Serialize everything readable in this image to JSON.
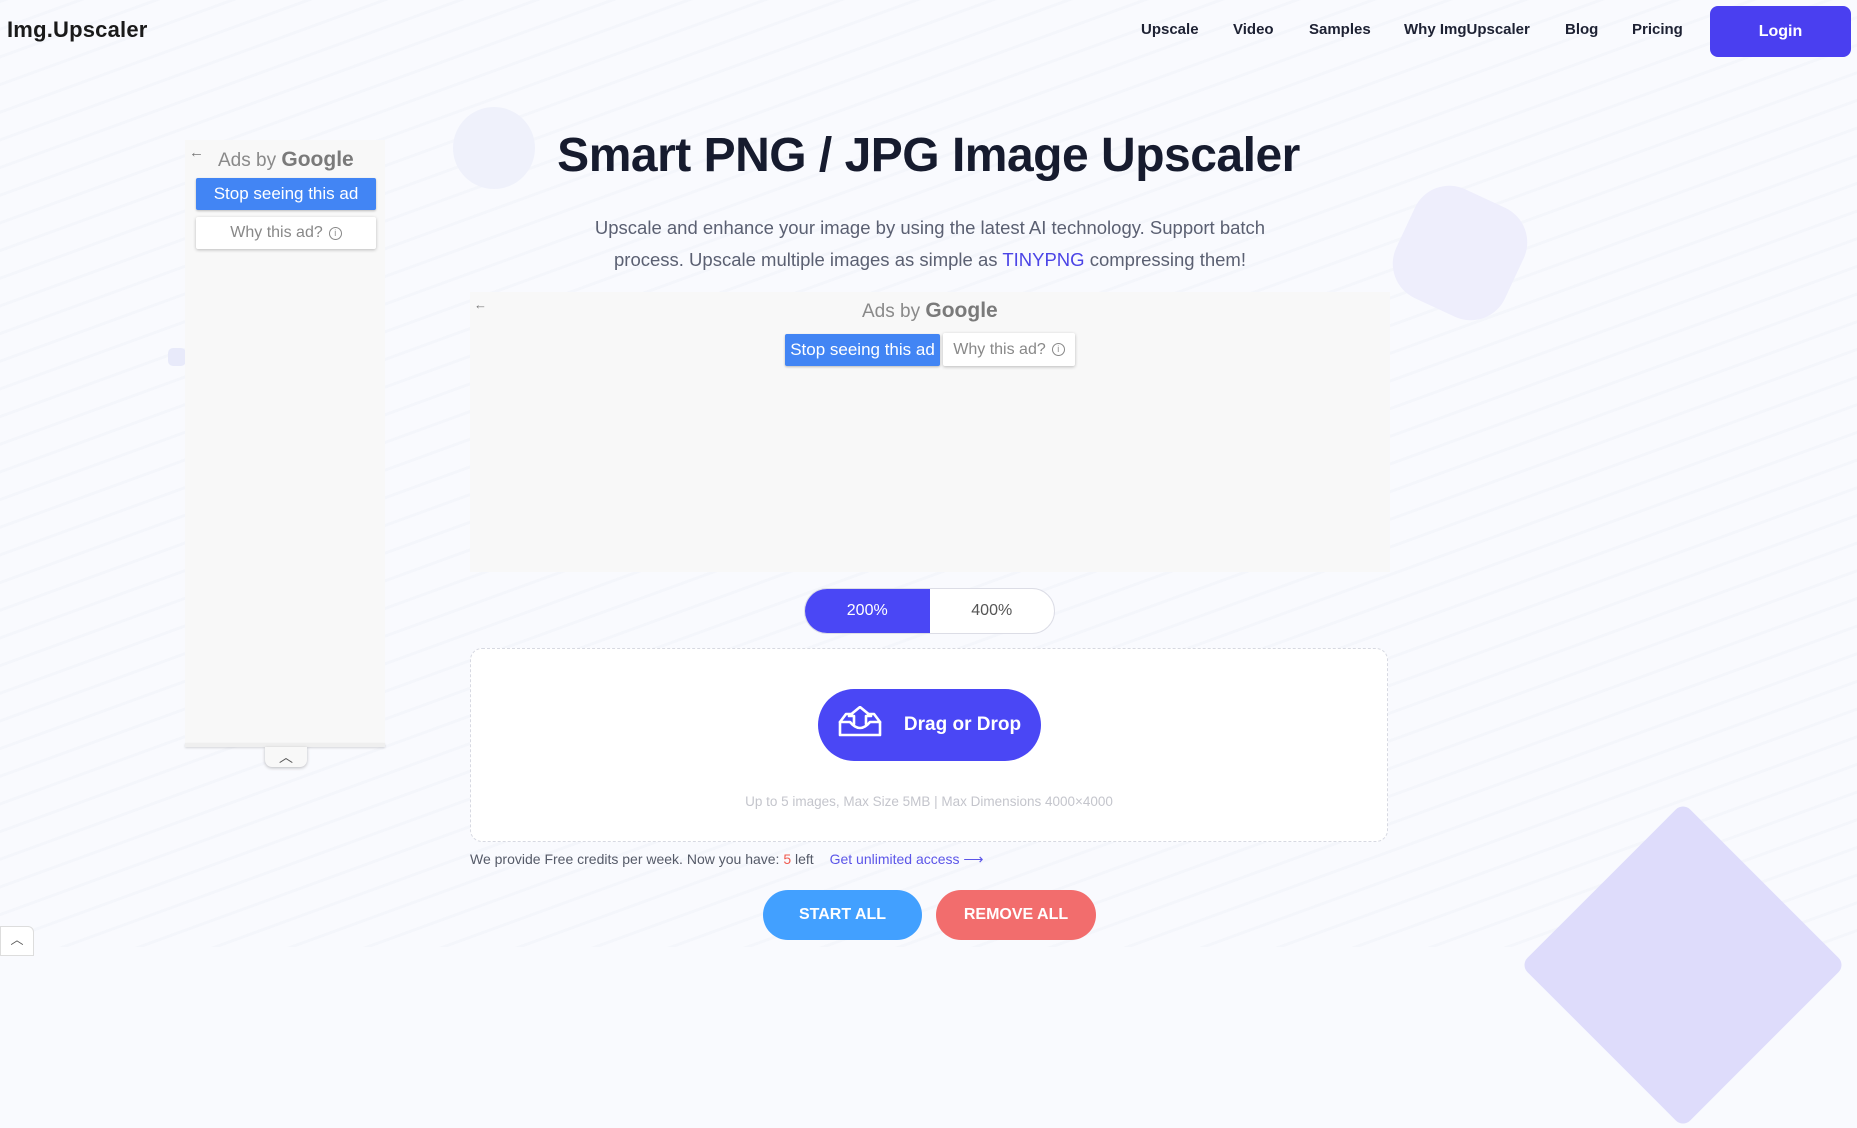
{
  "header": {
    "logo": "Img.Upscaler",
    "nav": [
      {
        "label": "Upscale"
      },
      {
        "label": "Video"
      },
      {
        "label": "Samples"
      },
      {
        "label": "Why ImgUpscaler"
      },
      {
        "label": "Blog"
      },
      {
        "label": "Pricing"
      }
    ],
    "login_label": "Login"
  },
  "ads": {
    "back_icon": "←",
    "ads_by": "Ads by",
    "google": "Google",
    "stop_label": "Stop seeing this ad",
    "why_label": "Why this ad?",
    "info_icon": "i",
    "collapse_icon": "︿"
  },
  "hero": {
    "title": "Smart PNG / JPG Image Upscaler",
    "subtitle_part1": "Upscale and enhance your image by using the latest AI technology. Support batch process. Upscale multiple images as simple as ",
    "subtitle_link": "TINYPNG",
    "subtitle_part2": " compressing them!"
  },
  "scale_toggle": {
    "options": [
      {
        "label": "200%",
        "active": true
      },
      {
        "label": "400%",
        "active": false
      }
    ]
  },
  "upload": {
    "drag_label": "Drag or Drop",
    "limits": "Up to 5 images, Max Size 5MB | Max Dimensions 4000×4000"
  },
  "credits": {
    "prefix": "We provide Free credits per week. Now you have: ",
    "count": "5",
    "suffix": " left",
    "link": "Get unlimited access ⟶"
  },
  "actions": {
    "start_label": "START ALL",
    "remove_label": "REMOVE ALL"
  },
  "colors": {
    "brand": "#4a3ff0",
    "accent": "#4a47f5",
    "start": "#42a0ff",
    "remove": "#f26d6d",
    "credit_count": "#f05a4f"
  }
}
